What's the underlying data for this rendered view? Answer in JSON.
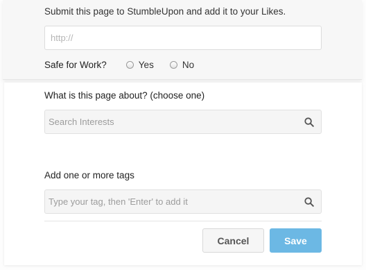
{
  "header": {
    "intro": "Submit this page to StumbleUpon and add it to your Likes."
  },
  "url_field": {
    "placeholder": "http://",
    "value": ""
  },
  "safe_for_work": {
    "label": "Safe for Work?",
    "options": [
      "Yes",
      "No"
    ],
    "selected": null
  },
  "about": {
    "label": "What is this page about? (choose one)",
    "placeholder": "Search Interests"
  },
  "tags": {
    "label": "Add one or more tags",
    "placeholder": "Type your tag, then 'Enter' to add it"
  },
  "actions": {
    "cancel_label": "Cancel",
    "save_label": "Save"
  },
  "colors": {
    "accent": "#6cb8e4",
    "panel": "#f7f7f7",
    "field": "#f5f5f5"
  },
  "icons": [
    "magnifier-icon"
  ]
}
